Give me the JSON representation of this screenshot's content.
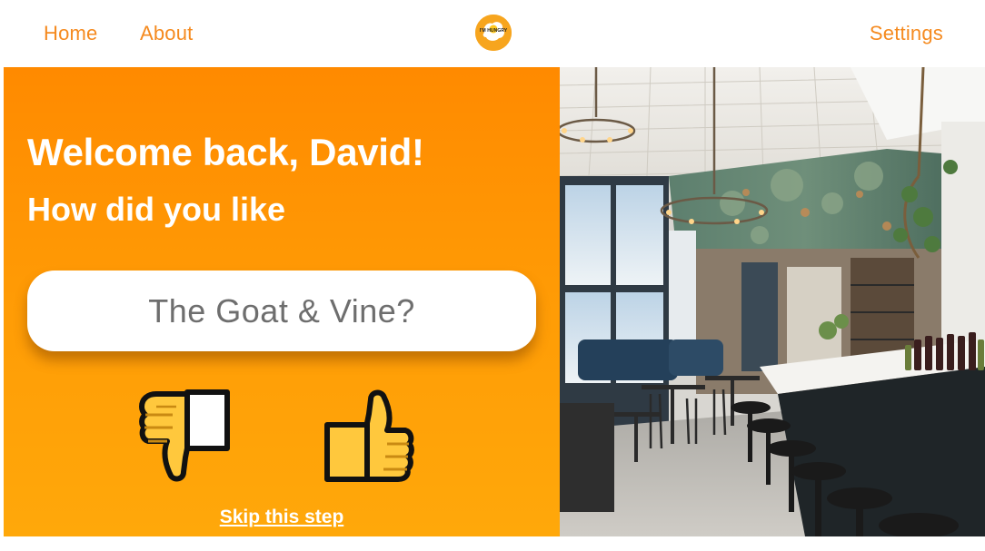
{
  "nav": {
    "home_label": "Home",
    "about_label": "About",
    "settings_label": "Settings",
    "logo_text": "I'M HUNGRY"
  },
  "prompt": {
    "welcome": "Welcome back, David!",
    "question": "How did you like",
    "restaurant": "The Goat & Vine?",
    "skip_label": "Skip this step"
  },
  "icons": {
    "dislike": "thumbs-down-icon",
    "like": "thumbs-up-icon",
    "logo": "fried-egg-icon"
  },
  "colors": {
    "accent": "#f58a1f",
    "panel_top": "#ff8a00",
    "panel_bottom": "#ffa80a",
    "thumb_fill": "#ffc83d",
    "pill_text": "#6e6e6e"
  },
  "image": {
    "subject": "restaurant-interior-photo"
  }
}
